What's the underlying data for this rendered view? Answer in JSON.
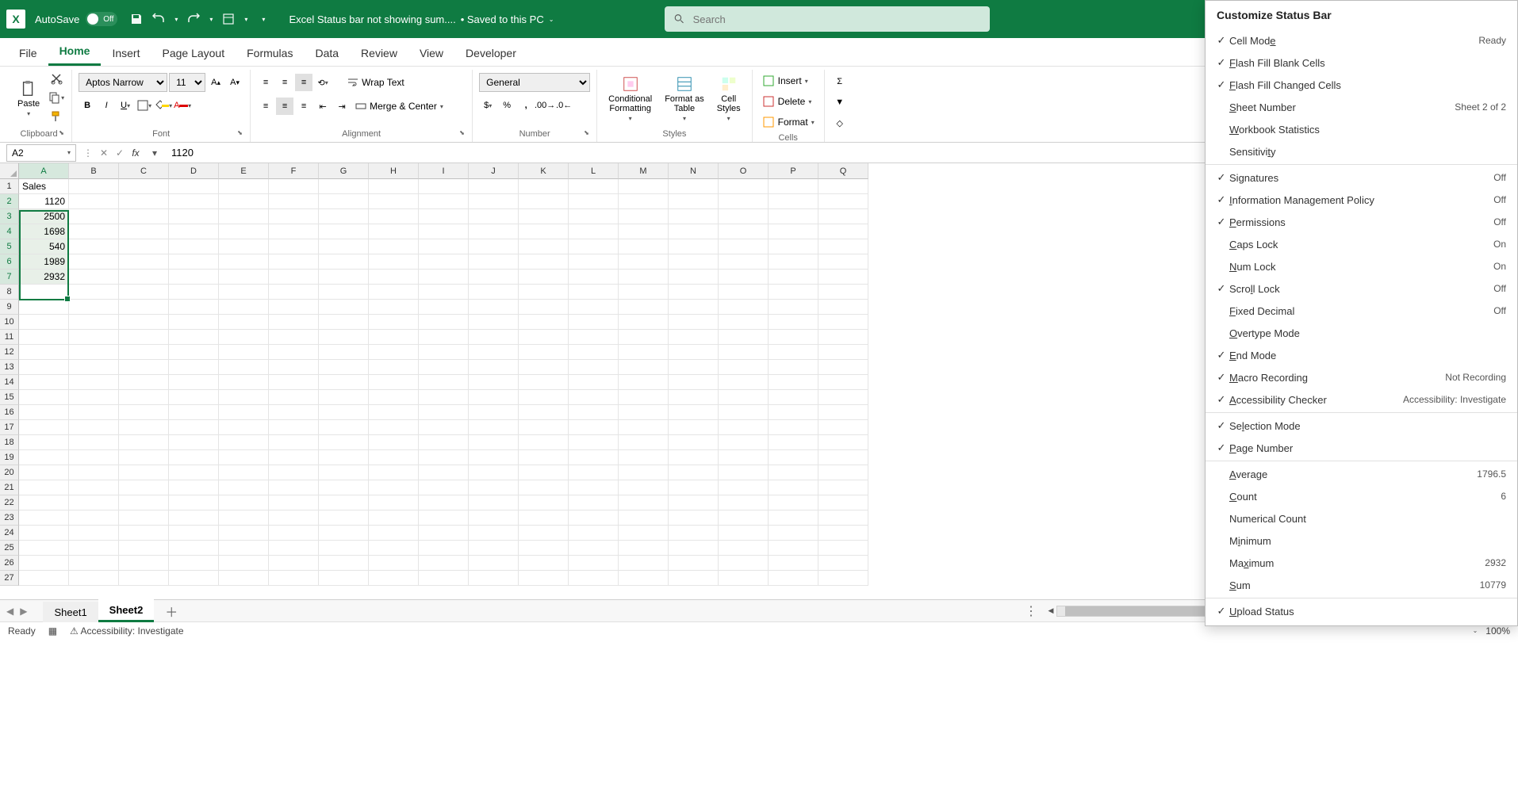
{
  "title_bar": {
    "autosave_label": "AutoSave",
    "autosave_state": "Off",
    "doc_name": "Excel Status bar not showing sum....",
    "save_status": "• Saved to this PC",
    "search_placeholder": "Search"
  },
  "tabs": [
    "File",
    "Home",
    "Insert",
    "Page Layout",
    "Formulas",
    "Data",
    "Review",
    "View",
    "Developer"
  ],
  "active_tab": "Home",
  "ribbon": {
    "clipboard": {
      "label": "Clipboard",
      "paste": "Paste"
    },
    "font": {
      "label": "Font",
      "name": "Aptos Narrow",
      "size": "11"
    },
    "alignment": {
      "label": "Alignment",
      "wrap": "Wrap Text",
      "merge": "Merge & Center"
    },
    "number": {
      "label": "Number",
      "format": "General"
    },
    "styles": {
      "label": "Styles",
      "cond": "Conditional\nFormatting",
      "table": "Format as\nTable",
      "cell": "Cell\nStyles"
    },
    "cells": {
      "label": "Cells",
      "insert": "Insert",
      "delete": "Delete",
      "format": "Format"
    }
  },
  "name_box": "A2",
  "formula_bar": "1120",
  "columns": [
    "A",
    "B",
    "C",
    "D",
    "E",
    "F",
    "G",
    "H",
    "I",
    "J",
    "K",
    "L",
    "M",
    "N",
    "O",
    "P",
    "Q"
  ],
  "rows": 27,
  "sheet_data": {
    "A1": "Sales",
    "A2": "1120",
    "A3": "2500",
    "A4": "1698",
    "A5": "540",
    "A6": "1989",
    "A7": "2932"
  },
  "selected_rows": [
    2,
    3,
    4,
    5,
    6,
    7
  ],
  "selected_col": "A",
  "sheets": [
    "Sheet1",
    "Sheet2"
  ],
  "active_sheet": "Sheet2",
  "status_bar": {
    "mode": "Ready",
    "accessibility": "Accessibility: Investigate",
    "zoom": "100%"
  },
  "customize_status_bar": {
    "title": "Customize Status Bar",
    "items": [
      {
        "checked": true,
        "label": "Cell Mode",
        "u": 8,
        "value": "Ready"
      },
      {
        "checked": true,
        "label": "Flash Fill Blank Cells",
        "u": 0
      },
      {
        "checked": true,
        "label": "Flash Fill Changed Cells",
        "u": 0
      },
      {
        "checked": false,
        "label": "Sheet Number",
        "u": 0,
        "value": "Sheet 2 of 2"
      },
      {
        "checked": false,
        "label": "Workbook Statistics",
        "u": 0
      },
      {
        "checked": false,
        "label": "Sensitivity",
        "u": 9
      },
      {
        "sep": true
      },
      {
        "checked": true,
        "label": "Signatures",
        "u": 2,
        "value": "Off"
      },
      {
        "checked": true,
        "label": "Information Management Policy",
        "u": 0,
        "value": "Off"
      },
      {
        "checked": true,
        "label": "Permissions",
        "u": 0,
        "value": "Off"
      },
      {
        "checked": false,
        "label": "Caps Lock",
        "u": 0,
        "value": "On"
      },
      {
        "checked": false,
        "label": "Num Lock",
        "u": 0,
        "value": "On"
      },
      {
        "checked": true,
        "label": "Scroll Lock",
        "u": 4,
        "value": "Off"
      },
      {
        "checked": false,
        "label": "Fixed Decimal",
        "u": 0,
        "value": "Off"
      },
      {
        "checked": false,
        "label": "Overtype Mode",
        "u": 0
      },
      {
        "checked": true,
        "label": "End Mode",
        "u": 0
      },
      {
        "checked": true,
        "label": "Macro Recording",
        "u": 0,
        "value": "Not Recording"
      },
      {
        "checked": true,
        "label": "Accessibility Checker",
        "u": 0,
        "value": "Accessibility: Investigate"
      },
      {
        "sep": true
      },
      {
        "checked": true,
        "label": "Selection Mode",
        "u": 2
      },
      {
        "checked": true,
        "label": "Page Number",
        "u": 0
      },
      {
        "sep": true
      },
      {
        "checked": false,
        "label": "Average",
        "u": 0,
        "value": "1796.5"
      },
      {
        "checked": false,
        "label": "Count",
        "u": 0,
        "value": "6"
      },
      {
        "checked": false,
        "label": "Numerical Count",
        "u": 15
      },
      {
        "checked": false,
        "label": "Minimum",
        "u": 1
      },
      {
        "checked": false,
        "label": "Maximum",
        "u": 2,
        "value": "2932"
      },
      {
        "checked": false,
        "label": "Sum",
        "u": 0,
        "value": "10779"
      },
      {
        "sep": true
      },
      {
        "checked": true,
        "label": "Upload Status",
        "u": 0
      }
    ]
  }
}
